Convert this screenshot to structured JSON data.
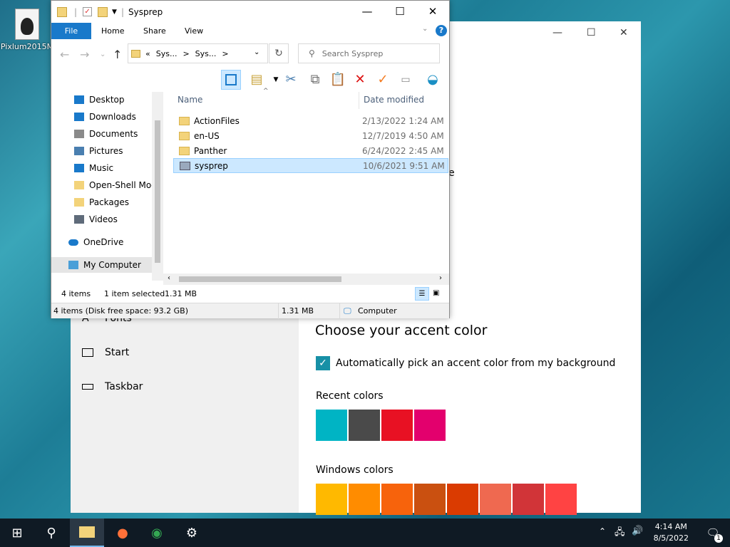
{
  "desktop": {
    "icon_label": "Pixlum2015M"
  },
  "settings": {
    "nav": [
      {
        "label": "Fonts",
        "icon": "font-icon"
      },
      {
        "label": "Start",
        "icon": "start-icon"
      },
      {
        "label": "Taskbar",
        "icon": "taskbar-icon"
      }
    ],
    "accent_title": "Choose your accent color",
    "auto_pick": "Automatically pick an accent color from my background",
    "recent_label": "Recent colors",
    "windows_label": "Windows colors",
    "recent_colors": [
      "#00b4c4",
      "#4a4a4a",
      "#e81123",
      "#e3006d"
    ],
    "windows_colors": [
      "#ffb900",
      "#ff8c00",
      "#f7630c",
      "#ca5010",
      "#da3b01",
      "#ef6950",
      "#d13438",
      "#ff4343"
    ],
    "cut_text": "e"
  },
  "explorer": {
    "title": "Sysprep",
    "tabs": [
      "File",
      "Home",
      "Share",
      "View"
    ],
    "address": [
      "«",
      "Sys...",
      ">",
      "Sys...",
      ">"
    ],
    "search_placeholder": "Search Sysprep",
    "nav_items": [
      {
        "label": "Desktop",
        "icon": "desktop-icon",
        "pinned": true
      },
      {
        "label": "Downloads",
        "icon": "downloads-icon",
        "pinned": true
      },
      {
        "label": "Documents",
        "icon": "documents-icon",
        "pinned": true
      },
      {
        "label": "Pictures",
        "icon": "pictures-icon",
        "pinned": true
      },
      {
        "label": "Music",
        "icon": "music-icon",
        "pinned": false
      },
      {
        "label": "Open-Shell Mod",
        "icon": "folder-icon",
        "pinned": false
      },
      {
        "label": "Packages",
        "icon": "folder-icon",
        "pinned": false
      },
      {
        "label": "Videos",
        "icon": "videos-icon",
        "pinned": false
      },
      {
        "label": "OneDrive",
        "icon": "onedrive-icon",
        "pinned": false
      },
      {
        "label": "My Computer",
        "icon": "computer-icon",
        "pinned": false
      }
    ],
    "columns": {
      "name": "Name",
      "date": "Date modified"
    },
    "files": [
      {
        "name": "ActionFiles",
        "date": "2/13/2022 1:24 AM",
        "type": "folder"
      },
      {
        "name": "en-US",
        "date": "12/7/2019 4:50 AM",
        "type": "folder"
      },
      {
        "name": "Panther",
        "date": "6/24/2022 2:45 AM",
        "type": "folder"
      },
      {
        "name": "sysprep",
        "date": "10/6/2021 9:51 AM",
        "type": "exe"
      }
    ],
    "status": {
      "items": "4 items",
      "selected": "1 item selected",
      "size": "1.31 MB"
    },
    "details": {
      "info": "4 items (Disk free space: 93.2 GB)",
      "size": "1.31 MB",
      "location": "Computer"
    }
  },
  "taskbar": {
    "time": "4:14 AM",
    "date": "8/5/2022",
    "notifications": "1"
  }
}
